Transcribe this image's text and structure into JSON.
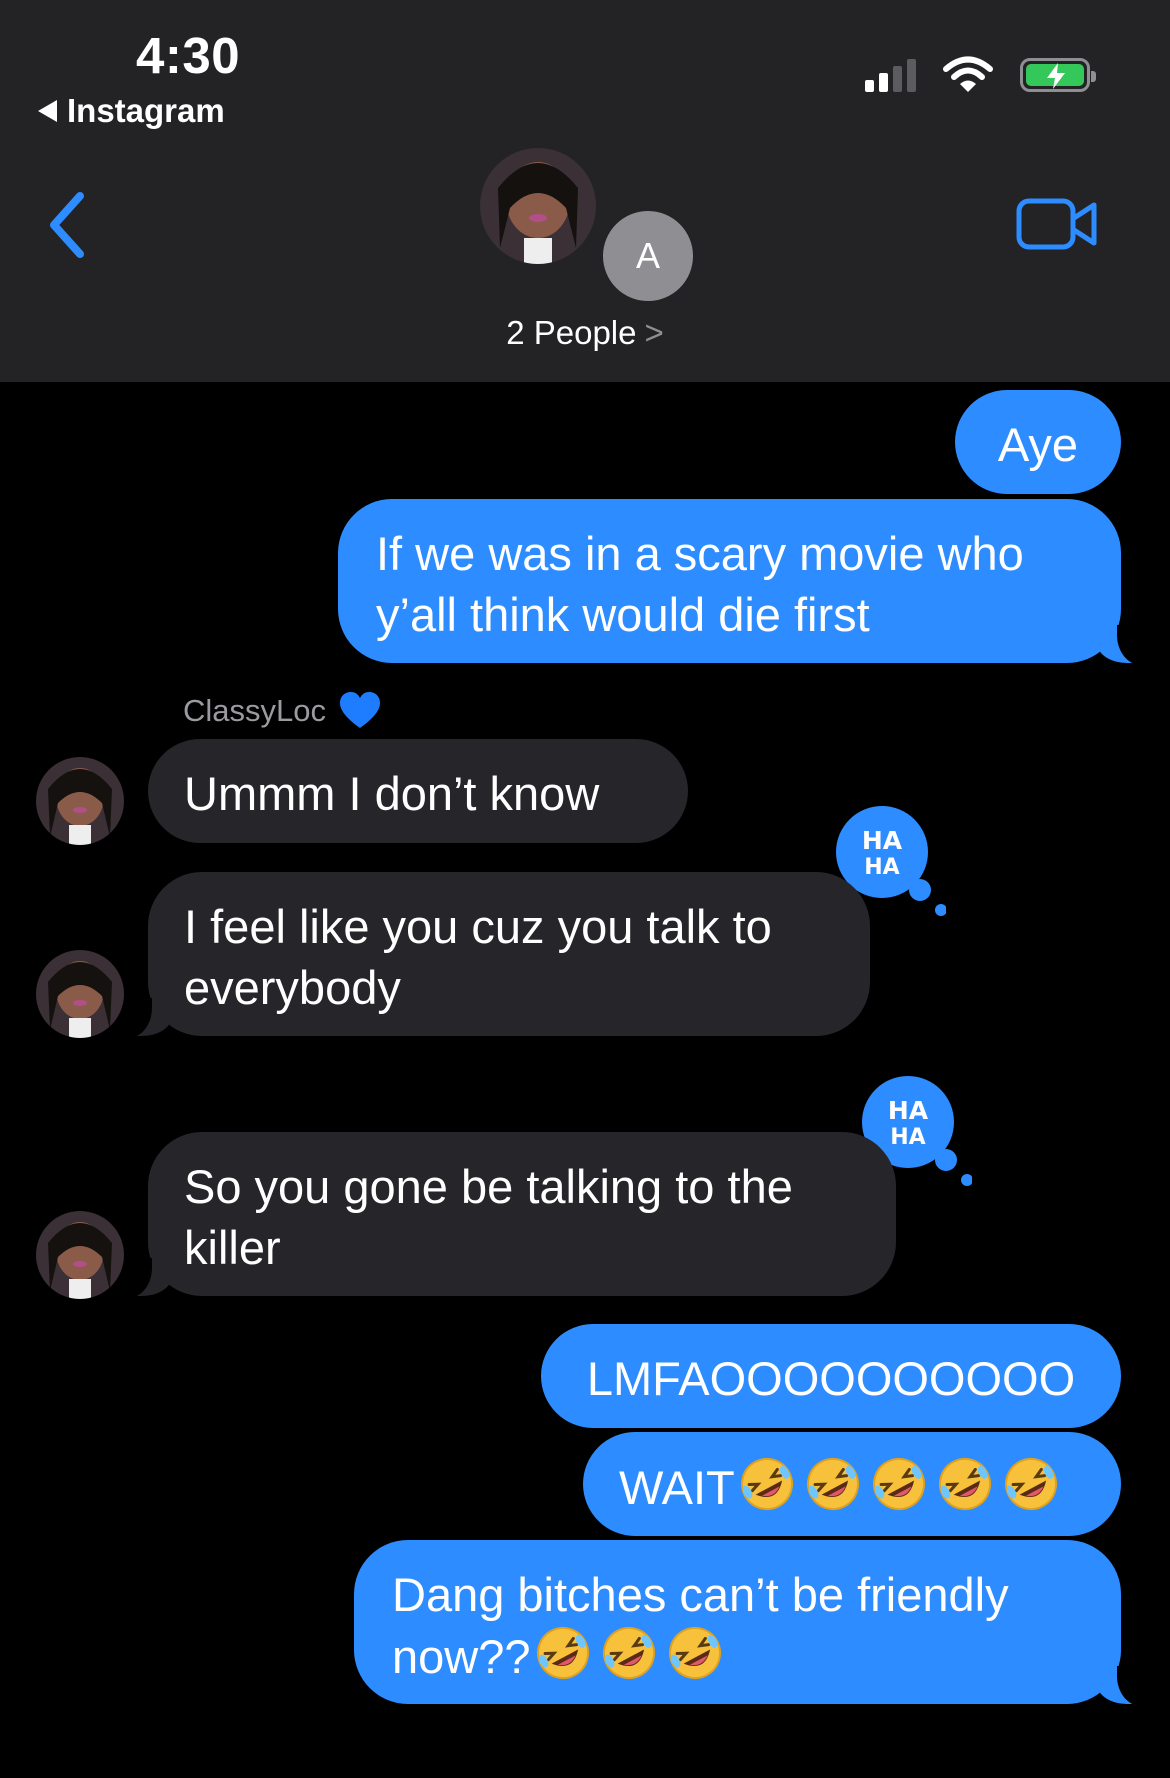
{
  "status_bar": {
    "time": "4:30",
    "back_app_label": "Instagram"
  },
  "header": {
    "second_avatar_initial": "A",
    "participants_label": "2 People",
    "participants_chevron": ">"
  },
  "messages": [
    {
      "type": "sent",
      "text": "Aye"
    },
    {
      "type": "sent",
      "text": "If we was in a scary movie who y’all think would die first"
    },
    {
      "type": "sender",
      "name": "ClassyLoc"
    },
    {
      "type": "received",
      "text": "Ummm I don’t know"
    },
    {
      "type": "received",
      "text": "I feel like you cuz you talk to everybody",
      "tapback": "haha"
    },
    {
      "type": "received",
      "text": "So you gone be talking to the killer",
      "tapback": "haha"
    },
    {
      "type": "sent",
      "text": "LMFAOOOOOOOOOO"
    },
    {
      "type": "sent",
      "text": "WAIT",
      "emoji": "rolling-on-floor-laughing",
      "emoji_count": 5
    },
    {
      "type": "sent",
      "text": "Dang bitches can’t be friendly now??",
      "emoji": "rolling-on-floor-laughing",
      "emoji_count": 3
    }
  ],
  "tapback_label": "HA HA",
  "colors": {
    "sent_bubble": "#2d8cff",
    "received_bubble": "#26262a",
    "header_bg": "#232325",
    "accent": "#2d8cff",
    "battery": "#34c759"
  }
}
